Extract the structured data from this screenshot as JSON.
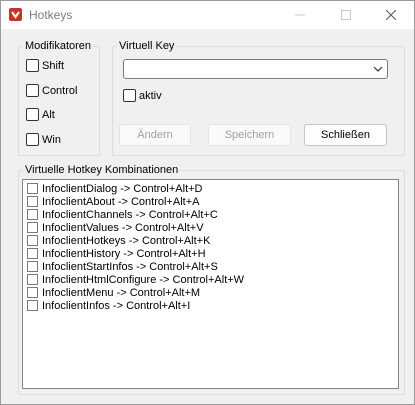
{
  "window": {
    "title": "Hotkeys",
    "icon": "app-logo-icon",
    "controls": [
      "minimize-icon",
      "maximize-icon",
      "close-icon"
    ]
  },
  "modifiers": {
    "legend": "Modifikatoren",
    "items": [
      {
        "label": "Shift",
        "checked": false
      },
      {
        "label": "Control",
        "checked": false
      },
      {
        "label": "Alt",
        "checked": false
      },
      {
        "label": "Win",
        "checked": false
      }
    ]
  },
  "virtual_key": {
    "legend": "Virtuell Key",
    "select_value": "",
    "active_label": "aktiv",
    "active_checked": false
  },
  "buttons": {
    "change_label": "Ändern",
    "save_label": "Speichern",
    "close_label": "Schließen"
  },
  "combinations": {
    "legend": "Virtuelle Hotkey Kombinationen",
    "items": [
      {
        "label": "InfoclientDialog -> Control+Alt+D",
        "checked": false
      },
      {
        "label": "InfoclientAbout -> Control+Alt+A",
        "checked": false
      },
      {
        "label": "InfoclientChannels -> Control+Alt+C",
        "checked": false
      },
      {
        "label": "InfoclientValues -> Control+Alt+V",
        "checked": false
      },
      {
        "label": "InfoclientHotkeys -> Control+Alt+K",
        "checked": false
      },
      {
        "label": "InfoclientHistory -> Control+Alt+H",
        "checked": false
      },
      {
        "label": "InfoclientStartInfos -> Control+Alt+S",
        "checked": false
      },
      {
        "label": "InfoclientHtmlConfigure -> Control+Alt+W",
        "checked": false
      },
      {
        "label": "InfoclientMenu -> Control+Alt+M",
        "checked": false
      },
      {
        "label": "InfoclientInfos -> Control+Alt+I",
        "checked": false
      }
    ]
  },
  "colors": {
    "window_bg": "#f0f0f0",
    "titlebar_bg": "#ffffff",
    "app_icon_red": "#c8322b",
    "disabled_text": "#a0a0a0"
  }
}
